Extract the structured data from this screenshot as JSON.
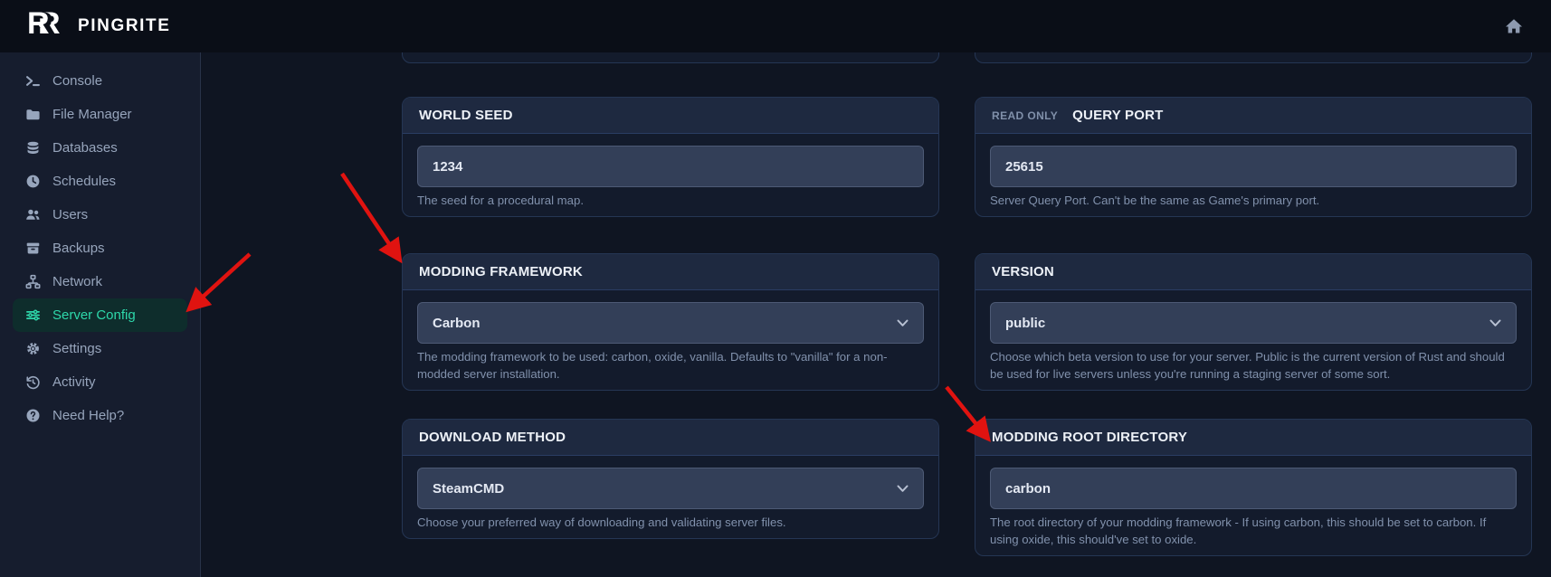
{
  "brand": {
    "name": "PINGRITE",
    "logo_letter": "R"
  },
  "topbar": {
    "home_icon": "home"
  },
  "sidebar": {
    "items": [
      {
        "label": "Console",
        "icon": "terminal-icon",
        "active": false
      },
      {
        "label": "File Manager",
        "icon": "folder-icon",
        "active": false
      },
      {
        "label": "Databases",
        "icon": "database-icon",
        "active": false
      },
      {
        "label": "Schedules",
        "icon": "clock-icon",
        "active": false
      },
      {
        "label": "Users",
        "icon": "users-icon",
        "active": false
      },
      {
        "label": "Backups",
        "icon": "archive-icon",
        "active": false
      },
      {
        "label": "Network",
        "icon": "network-icon",
        "active": false
      },
      {
        "label": "Server Config",
        "icon": "sliders-icon",
        "active": true
      },
      {
        "label": "Settings",
        "icon": "gear-icon",
        "active": false
      },
      {
        "label": "Activity",
        "icon": "history-icon",
        "active": false
      },
      {
        "label": "Need Help?",
        "icon": "help-icon",
        "active": false
      }
    ]
  },
  "cards": {
    "world_seed": {
      "title": "WORLD SEED",
      "control": "input",
      "value": "1234",
      "helper": "The seed for a procedural map."
    },
    "query_port": {
      "badge": "READ ONLY",
      "title": "QUERY PORT",
      "control": "input",
      "value": "25615",
      "helper": "Server Query Port. Can't be the same as Game's primary port."
    },
    "modding_framework": {
      "title": "MODDING FRAMEWORK",
      "control": "select",
      "value": "Carbon",
      "helper": "The modding framework to be used: carbon, oxide, vanilla. Defaults to \"vanilla\" for a non-modded server installation."
    },
    "version": {
      "title": "VERSION",
      "control": "select",
      "value": "public",
      "helper": "Choose which beta version to use for your server. Public is the current version of Rust and should be used for live servers unless you're running a staging server of some sort."
    },
    "download_method": {
      "title": "DOWNLOAD METHOD",
      "control": "select",
      "value": "SteamCMD",
      "helper": "Choose your preferred way of downloading and validating server files."
    },
    "modding_root_directory": {
      "title": "MODDING ROOT DIRECTORY",
      "control": "input",
      "value": "carbon",
      "helper": "The root directory of your modding framework - If using carbon, this should be set to carbon. If using oxide, this should've set to oxide."
    }
  },
  "colors": {
    "accent_teal": "#2ed8ab",
    "arrow_red": "#e01310",
    "topbar_bg": "#0a0e17",
    "sidebar_bg": "#161d2e",
    "card_header_bg": "#1e2940",
    "card_body_bg": "#131b2c",
    "input_bg": "#333f58"
  }
}
